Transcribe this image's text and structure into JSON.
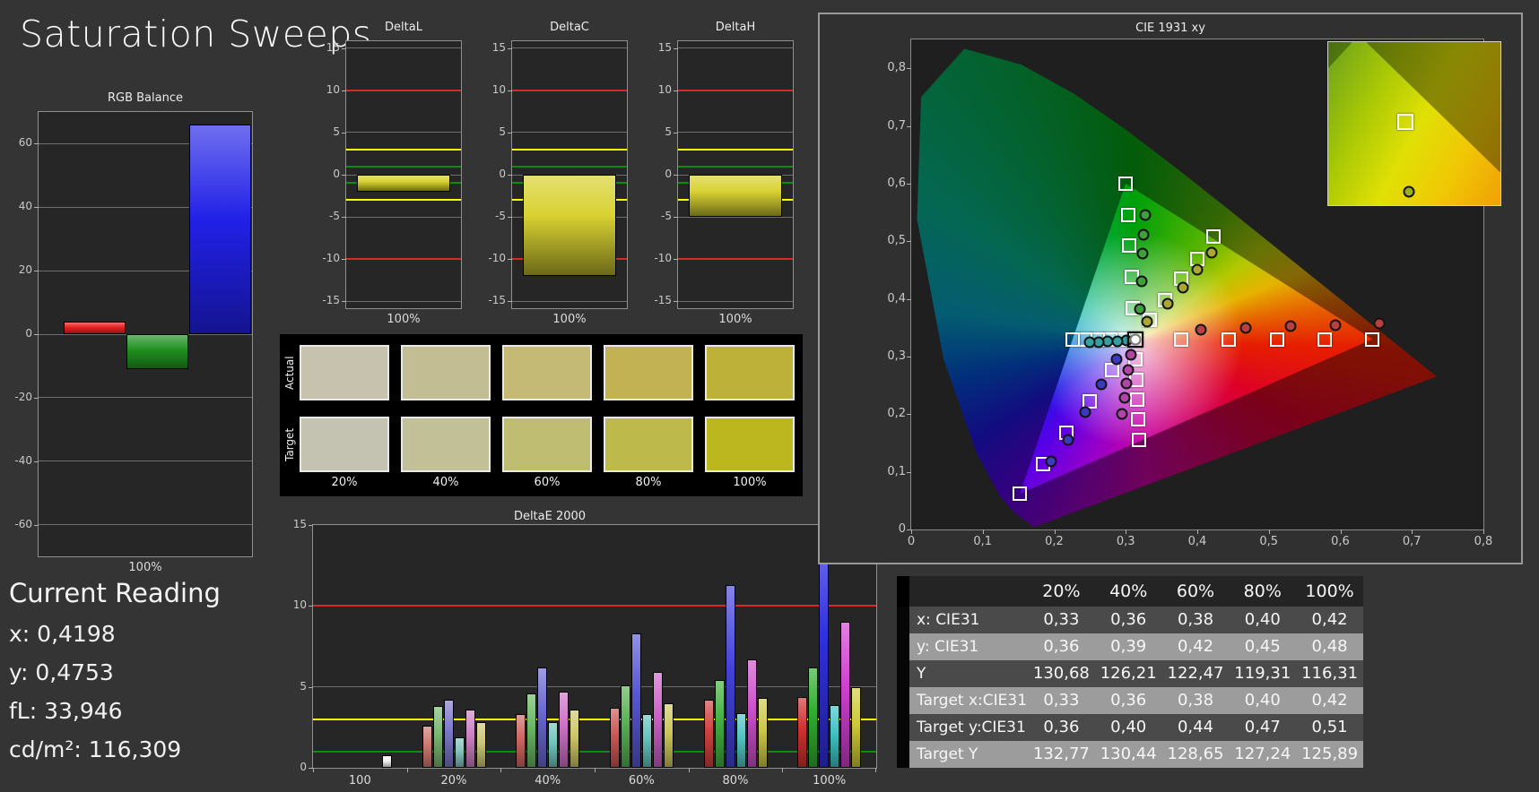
{
  "title": "Saturation Sweeps",
  "current_reading": {
    "title": "Current Reading",
    "lines": [
      {
        "label": "x",
        "value": "0,4198"
      },
      {
        "label": "y",
        "value": "0,4753"
      },
      {
        "label": "fL",
        "value": "33,946"
      },
      {
        "label": "cd/m²",
        "value": "116,309"
      }
    ]
  },
  "colors": {
    "background": "#343434",
    "plot_bg": "#262626",
    "plot_border": "#8f8f8f",
    "grid": "#6e6e6e",
    "ref_red": "#d42a2a",
    "ref_yellow": "#ffff00",
    "ref_green": "#0a8f0a",
    "table_dark": "#4a4a4a",
    "table_light": "#9c9c9c",
    "table_header_bg": "#242424",
    "table_gutter": "#060606",
    "swatch_panel_bg": "#000000"
  },
  "swatches": {
    "row_labels": [
      "Actual",
      "Target"
    ],
    "col_labels": [
      "20%",
      "40%",
      "60%",
      "80%",
      "100%"
    ],
    "actual_colors": [
      "#c6c2ae",
      "#c3bd93",
      "#c4ba76",
      "#c3b254",
      "#beb13a"
    ],
    "target_colors": [
      "#c4c2b0",
      "#c1c097",
      "#bfbd72",
      "#bdba4b",
      "#bcb71f"
    ]
  },
  "table": {
    "columns": [
      "20%",
      "40%",
      "60%",
      "80%",
      "100%"
    ],
    "rows": [
      {
        "label": "x: CIE31",
        "shade": "dark",
        "values": [
          "0,33",
          "0,36",
          "0,38",
          "0,40",
          "0,42"
        ]
      },
      {
        "label": "y: CIE31",
        "shade": "light",
        "values": [
          "0,36",
          "0,39",
          "0,42",
          "0,45",
          "0,48"
        ]
      },
      {
        "label": "Y",
        "shade": "dark",
        "values": [
          "130,68",
          "126,21",
          "122,47",
          "119,31",
          "116,31"
        ]
      },
      {
        "label": "Target x:CIE31",
        "shade": "light",
        "values": [
          "0,33",
          "0,36",
          "0,38",
          "0,40",
          "0,42"
        ]
      },
      {
        "label": "Target y:CIE31",
        "shade": "dark",
        "values": [
          "0,36",
          "0,40",
          "0,44",
          "0,47",
          "0,51"
        ]
      },
      {
        "label": "Target Y",
        "shade": "light",
        "values": [
          "132,77",
          "130,44",
          "128,65",
          "127,24",
          "125,89"
        ]
      }
    ]
  },
  "chart_data": [
    {
      "id": "rgb_balance",
      "type": "bar",
      "title": "RGB Balance",
      "xlabel": "100%",
      "categories": [
        "Red",
        "Green",
        "Blue"
      ],
      "values": [
        4,
        -11,
        66
      ],
      "bar_colors": [
        "#e82020",
        "#1f8f1f",
        "#2121e8"
      ],
      "ylim": [
        -70,
        70
      ],
      "yticks": [
        60,
        40,
        20,
        0,
        -20,
        -40,
        -60
      ],
      "gridticks": [
        60,
        40,
        20,
        0,
        -20,
        -40,
        -60
      ]
    },
    {
      "id": "delta_l",
      "type": "bar",
      "title": "DeltaL",
      "xlabel": "100%",
      "categories": [
        "100%"
      ],
      "values": [
        -2
      ],
      "bar_colors": [
        "#d8d232"
      ],
      "ylim": [
        -15.8,
        15.8
      ],
      "yticks": [
        15,
        10,
        5,
        0,
        -5,
        -10,
        -15
      ],
      "gridticks": [
        15,
        5,
        0,
        -5,
        -15
      ],
      "ref_lines": [
        {
          "y": 10,
          "color": "#d42a2a"
        },
        {
          "y": -10,
          "color": "#d42a2a"
        },
        {
          "y": 3,
          "color": "#ffff00"
        },
        {
          "y": -3,
          "color": "#ffff00"
        },
        {
          "y": 1,
          "color": "#0a8f0a"
        },
        {
          "y": -1,
          "color": "#0a8f0a"
        }
      ]
    },
    {
      "id": "delta_c",
      "type": "bar",
      "title": "DeltaC",
      "xlabel": "100%",
      "categories": [
        "100%"
      ],
      "values": [
        -12
      ],
      "bar_colors": [
        "#d8d232"
      ],
      "ylim": [
        -15.8,
        15.8
      ],
      "yticks": [
        15,
        10,
        5,
        0,
        -5,
        -10,
        -15
      ],
      "gridticks": [
        15,
        5,
        0,
        -5,
        -15
      ],
      "ref_lines": [
        {
          "y": 10,
          "color": "#d42a2a"
        },
        {
          "y": -10,
          "color": "#d42a2a"
        },
        {
          "y": 3,
          "color": "#ffff00"
        },
        {
          "y": -3,
          "color": "#ffff00"
        },
        {
          "y": 1,
          "color": "#0a8f0a"
        },
        {
          "y": -1,
          "color": "#0a8f0a"
        }
      ]
    },
    {
      "id": "delta_h",
      "type": "bar",
      "title": "DeltaH",
      "xlabel": "100%",
      "categories": [
        "100%"
      ],
      "values": [
        -5
      ],
      "bar_colors": [
        "#d8d232"
      ],
      "ylim": [
        -15.8,
        15.8
      ],
      "yticks": [
        15,
        10,
        5,
        0,
        -5,
        -10,
        -15
      ],
      "gridticks": [
        15,
        5,
        0,
        -5,
        -15
      ],
      "ref_lines": [
        {
          "y": 10,
          "color": "#d42a2a"
        },
        {
          "y": -10,
          "color": "#d42a2a"
        },
        {
          "y": 3,
          "color": "#ffff00"
        },
        {
          "y": -3,
          "color": "#ffff00"
        },
        {
          "y": 1,
          "color": "#0a8f0a"
        },
        {
          "y": -1,
          "color": "#0a8f0a"
        }
      ]
    },
    {
      "id": "deltae2000",
      "type": "bar",
      "title": "DeltaE 2000",
      "ylim": [
        0,
        15
      ],
      "yticks": [
        15,
        10,
        5,
        0
      ],
      "gridticks": [
        5
      ],
      "ref_lines": [
        {
          "y": 10,
          "color": "#d42a2a"
        },
        {
          "y": 3,
          "color": "#ffff00"
        },
        {
          "y": 1,
          "color": "#0a8f0a"
        }
      ],
      "series_colors": {
        "red": "#d03030",
        "green": "#2fae2f",
        "blue": "#3030e0",
        "cyan": "#3fc3c3",
        "magenta": "#cf3fcf",
        "yellow": "#cfc93a",
        "white": "#f2f2f2"
      },
      "groups": [
        {
          "label": "100",
          "desat": 0,
          "bars": [
            {
              "series": "white",
              "value": 0.8,
              "slot": 5
            }
          ]
        },
        {
          "label": "20%",
          "desat": 0.5,
          "bars": [
            {
              "series": "red",
              "value": 2.6
            },
            {
              "series": "green",
              "value": 3.8
            },
            {
              "series": "blue",
              "value": 4.2
            },
            {
              "series": "cyan",
              "value": 1.9
            },
            {
              "series": "magenta",
              "value": 3.6
            },
            {
              "series": "yellow",
              "value": 2.8
            }
          ]
        },
        {
          "label": "40%",
          "desat": 0.38,
          "bars": [
            {
              "series": "red",
              "value": 3.3
            },
            {
              "series": "green",
              "value": 4.6
            },
            {
              "series": "blue",
              "value": 6.2
            },
            {
              "series": "cyan",
              "value": 2.8
            },
            {
              "series": "magenta",
              "value": 4.7
            },
            {
              "series": "yellow",
              "value": 3.6
            }
          ]
        },
        {
          "label": "60%",
          "desat": 0.26,
          "bars": [
            {
              "series": "red",
              "value": 3.7
            },
            {
              "series": "green",
              "value": 5.1
            },
            {
              "series": "blue",
              "value": 8.3
            },
            {
              "series": "cyan",
              "value": 3.3
            },
            {
              "series": "magenta",
              "value": 5.9
            },
            {
              "series": "yellow",
              "value": 4.0
            }
          ]
        },
        {
          "label": "80%",
          "desat": 0.13,
          "bars": [
            {
              "series": "red",
              "value": 4.2
            },
            {
              "series": "green",
              "value": 5.4
            },
            {
              "series": "blue",
              "value": 11.3
            },
            {
              "series": "cyan",
              "value": 3.4
            },
            {
              "series": "magenta",
              "value": 6.7
            },
            {
              "series": "yellow",
              "value": 4.3
            }
          ]
        },
        {
          "label": "100%",
          "desat": 0,
          "bars": [
            {
              "series": "red",
              "value": 4.4
            },
            {
              "series": "green",
              "value": 6.2
            },
            {
              "series": "blue",
              "value": 15.0
            },
            {
              "series": "cyan",
              "value": 3.9
            },
            {
              "series": "magenta",
              "value": 9.0
            },
            {
              "series": "yellow",
              "value": 5.0
            }
          ]
        }
      ]
    },
    {
      "id": "cie1931",
      "type": "scatter",
      "title": "CIE 1931 xy",
      "xlim": [
        0,
        0.8
      ],
      "ylim": [
        0,
        0.85
      ],
      "xticks": [
        "0",
        "0,1",
        "0,2",
        "0,3",
        "0,4",
        "0,5",
        "0,6",
        "0,7",
        "0,8"
      ],
      "yticks": [
        "0",
        "0,1",
        "0,2",
        "0,3",
        "0,4",
        "0,5",
        "0,6",
        "0,7",
        "0,8"
      ],
      "white_point": {
        "x": 0.313,
        "y": 0.329
      },
      "gamut_triangle": [
        [
          0.645,
          0.33
        ],
        [
          0.3,
          0.6
        ],
        [
          0.152,
          0.062
        ]
      ],
      "sweeps": [
        {
          "name": "red",
          "dot": "#b84040",
          "targets": [
            [
              0.377,
              0.33
            ],
            [
              0.444,
              0.33
            ],
            [
              0.511,
              0.33
            ],
            [
              0.578,
              0.33
            ],
            [
              0.645,
              0.33
            ]
          ],
          "measured": [
            [
              0.405,
              0.346
            ],
            [
              0.468,
              0.35
            ],
            [
              0.531,
              0.352
            ],
            [
              0.593,
              0.354
            ],
            [
              0.655,
              0.357
            ]
          ]
        },
        {
          "name": "green",
          "dot": "#3f9f3f",
          "targets": [
            [
              0.31,
              0.384
            ],
            [
              0.308,
              0.438
            ],
            [
              0.305,
              0.492
            ],
            [
              0.303,
              0.546
            ],
            [
              0.3,
              0.6
            ]
          ],
          "measured": [
            [
              0.32,
              0.382
            ],
            [
              0.322,
              0.43
            ],
            [
              0.324,
              0.478
            ],
            [
              0.325,
              0.512
            ],
            [
              0.327,
              0.545
            ]
          ]
        },
        {
          "name": "blue",
          "dot": "#3a3ac0",
          "targets": [
            [
              0.281,
              0.276
            ],
            [
              0.249,
              0.222
            ],
            [
              0.217,
              0.168
            ],
            [
              0.184,
              0.114
            ],
            [
              0.152,
              0.062
            ]
          ],
          "measured": [
            [
              0.287,
              0.296
            ],
            [
              0.266,
              0.252
            ],
            [
              0.243,
              0.204
            ],
            [
              0.219,
              0.155
            ],
            [
              0.196,
              0.118
            ]
          ]
        },
        {
          "name": "cyan",
          "dot": "#35a0a0",
          "targets": [
            [
              0.296,
              0.33
            ],
            [
              0.278,
              0.33
            ],
            [
              0.261,
              0.33
            ],
            [
              0.243,
              0.33
            ],
            [
              0.226,
              0.33
            ]
          ],
          "measured": [
            [
              0.301,
              0.328
            ],
            [
              0.288,
              0.327
            ],
            [
              0.275,
              0.326
            ],
            [
              0.262,
              0.325
            ],
            [
              0.249,
              0.324
            ]
          ]
        },
        {
          "name": "magenta",
          "dot": "#b045a5",
          "targets": [
            [
              0.314,
              0.295
            ],
            [
              0.315,
              0.26
            ],
            [
              0.316,
              0.226
            ],
            [
              0.317,
              0.191
            ],
            [
              0.318,
              0.156
            ]
          ],
          "measured": [
            [
              0.307,
              0.303
            ],
            [
              0.304,
              0.277
            ],
            [
              0.301,
              0.253
            ],
            [
              0.298,
              0.228
            ],
            [
              0.295,
              0.201
            ]
          ]
        },
        {
          "name": "yellow",
          "dot": "#aaa832",
          "targets": [
            [
              0.333,
              0.363
            ],
            [
              0.355,
              0.398
            ],
            [
              0.378,
              0.435
            ],
            [
              0.4,
              0.47
            ],
            [
              0.422,
              0.508
            ]
          ],
          "measured": [
            [
              0.33,
              0.36
            ],
            [
              0.358,
              0.392
            ],
            [
              0.38,
              0.42
            ],
            [
              0.4,
              0.45
            ],
            [
              0.42,
              0.48
            ]
          ]
        }
      ],
      "inset": {
        "square": {
          "x": 0.45,
          "y": 0.49
        },
        "circle": {
          "x": 0.47,
          "y": 0.92
        },
        "circle_color": "#9ab020"
      }
    }
  ]
}
